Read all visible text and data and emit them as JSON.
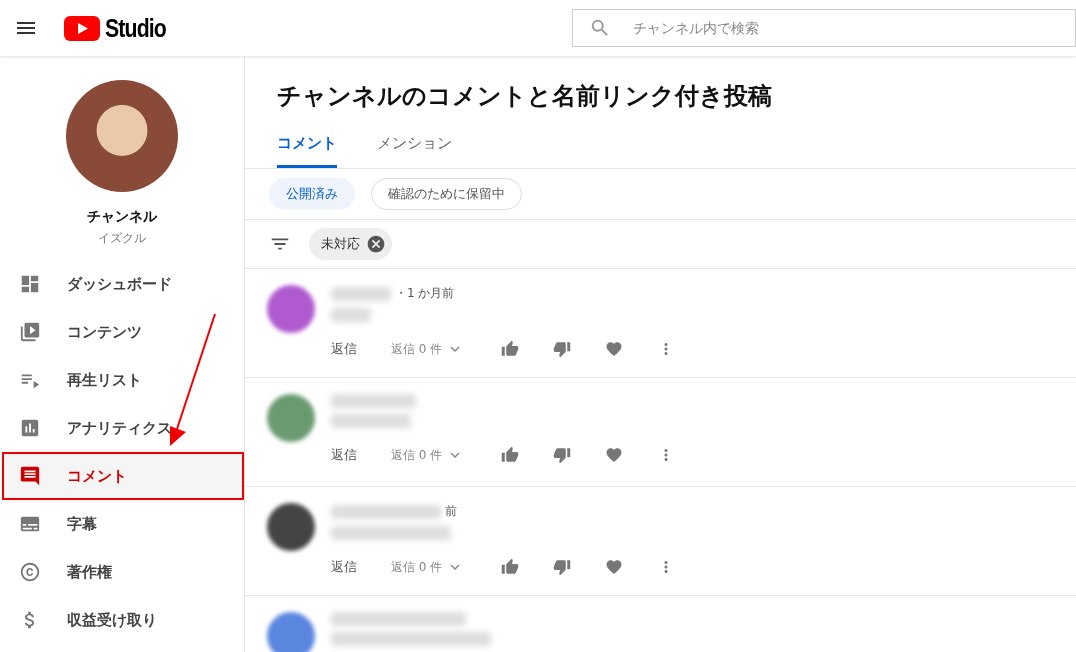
{
  "header": {
    "logo_text": "Studio",
    "search": {
      "placeholder": "チャンネル内で検索"
    }
  },
  "sidebar": {
    "channel": {
      "name": "チャンネル",
      "handle": "イズクル"
    },
    "items": [
      {
        "kind": "dashboard",
        "label": "ダッシュボード",
        "selected": false
      },
      {
        "kind": "content",
        "label": "コンテンツ",
        "selected": false
      },
      {
        "kind": "playlist",
        "label": "再生リスト",
        "selected": false
      },
      {
        "kind": "analytics",
        "label": "アナリティクス",
        "selected": false
      },
      {
        "kind": "comments",
        "label": "コメント",
        "selected": true
      },
      {
        "kind": "subtitles",
        "label": "字幕",
        "selected": false
      },
      {
        "kind": "copyright",
        "label": "著作権",
        "selected": false
      },
      {
        "kind": "monetization",
        "label": "収益受け取り",
        "selected": false
      }
    ]
  },
  "page": {
    "title": "チャンネルのコメントと名前リンク付き投稿",
    "tabs": [
      {
        "label": "コメント",
        "selected": true
      },
      {
        "label": "メンション",
        "selected": false
      }
    ],
    "chips": [
      {
        "label": "公開済み",
        "selected": true
      },
      {
        "label": "確認のために保留中",
        "selected": false
      }
    ],
    "filter": {
      "label": "未対応"
    },
    "comments": [
      {
        "color": "#b05ad0",
        "time": "・1 か月前",
        "reply": "返信",
        "replies": "返信 0 件"
      },
      {
        "color": "#6a9a70",
        "reply": "返信",
        "replies": "返信 0 件"
      },
      {
        "color": "#444444",
        "time": "前",
        "reply": "返信",
        "replies": "返信 0 件"
      },
      {
        "color": "#5b86e0"
      }
    ]
  }
}
